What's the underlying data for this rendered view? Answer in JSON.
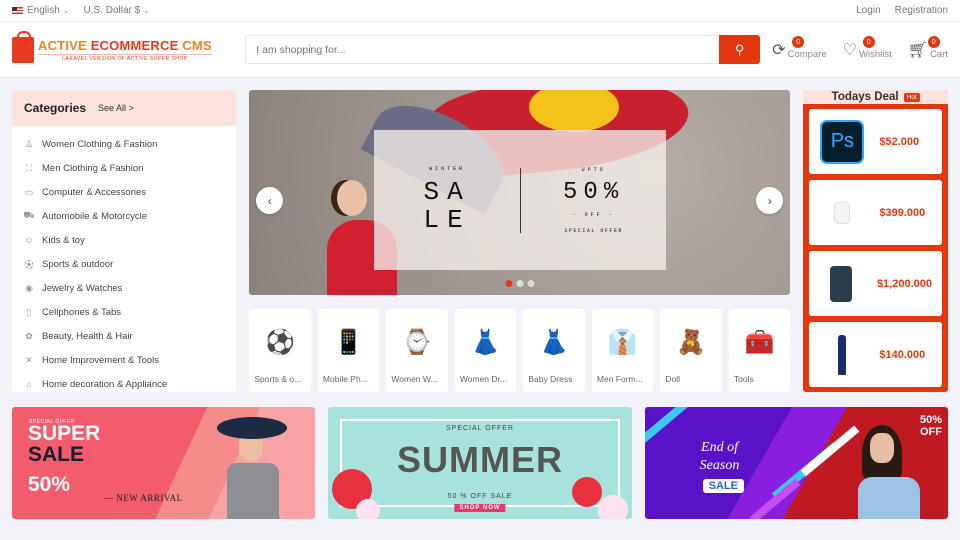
{
  "topbar": {
    "language": "English",
    "currency": "U.S. Dollar $",
    "login": "Login",
    "registration": "Registration"
  },
  "header": {
    "logo_word1": "ACTIVE ",
    "logo_word2": "ECOMMERCE",
    "logo_word3": " CMS",
    "logo_tagline": "LARAVEL VERSION OF ACTIVE SUPER SHOP",
    "search_placeholder": "I am shopping for...",
    "compare_label": "Compare",
    "compare_count": "0",
    "wishlist_label": "Wishlist",
    "wishlist_count": "0",
    "cart_label": "Cart",
    "cart_count": "0",
    "accent_color": "#e4370e"
  },
  "categories": {
    "title": "Categories",
    "see_all": "See All >",
    "items": [
      {
        "label": "Women Clothing & Fashion",
        "icon": "person-icon"
      },
      {
        "label": "Men Clothing & Fashion",
        "icon": "shirt-icon"
      },
      {
        "label": "Computer & Accessories",
        "icon": "monitor-icon"
      },
      {
        "label": "Automobile & Motorcycle",
        "icon": "car-icon"
      },
      {
        "label": "Kids & toy",
        "icon": "toy-icon"
      },
      {
        "label": "Sports & outdoor",
        "icon": "sports-icon"
      },
      {
        "label": "Jewelry & Watches",
        "icon": "watch-icon"
      },
      {
        "label": "Cellphones & Tabs",
        "icon": "phone-icon"
      },
      {
        "label": "Beauty, Health & Hair",
        "icon": "beauty-icon"
      },
      {
        "label": "Home Improvement & Tools",
        "icon": "tools-icon"
      },
      {
        "label": "Home decoration & Appliance",
        "icon": "home-icon"
      }
    ]
  },
  "slider": {
    "small_top_left": "WINTER",
    "sale_line1": "SA",
    "sale_line2": "LE",
    "small_top_right": "UPTO",
    "percent": "50%",
    "off": "- OFF -",
    "special": "SPECIAL OFFER",
    "prev": "‹",
    "next": "›",
    "active_slide": 1,
    "slide_count": 3
  },
  "featured_categories": [
    {
      "label": "Sports & o...",
      "emoji": "⚽"
    },
    {
      "label": "Mobile Ph...",
      "emoji": "📱"
    },
    {
      "label": "Women W...",
      "emoji": "⌚"
    },
    {
      "label": "Women Dr...",
      "emoji": "👗"
    },
    {
      "label": "Baby Dress",
      "emoji": "👗"
    },
    {
      "label": "Men Form...",
      "emoji": "👔"
    },
    {
      "label": "Doll",
      "emoji": "🧸"
    },
    {
      "label": "Tools",
      "emoji": "🧰"
    }
  ],
  "todays_deal": {
    "title": "Todays Deal",
    "hot": "Hot",
    "items": [
      {
        "price": "$52.000",
        "product": "Photoshop"
      },
      {
        "price": "$399.000",
        "product": "AirPods"
      },
      {
        "price": "$1,200.000",
        "product": "iPhone"
      },
      {
        "price": "$140.000",
        "product": "Dress"
      }
    ]
  },
  "banners": {
    "b1": {
      "special": "SPECIAL OFFER",
      "super": "SUPER",
      "sale": "SALE",
      "percent": "50%",
      "new_arrival": "— NEW ARRIVAL"
    },
    "b2": {
      "special": "SPECIAL OFFER",
      "summer": "SUMMER",
      "off": "50 % OFF SALE",
      "shop": "SHOP NOW"
    },
    "b3": {
      "end": "End of",
      "season": "Season",
      "sale": "SALE",
      "fifty": "50%",
      "off": "OFF"
    }
  }
}
